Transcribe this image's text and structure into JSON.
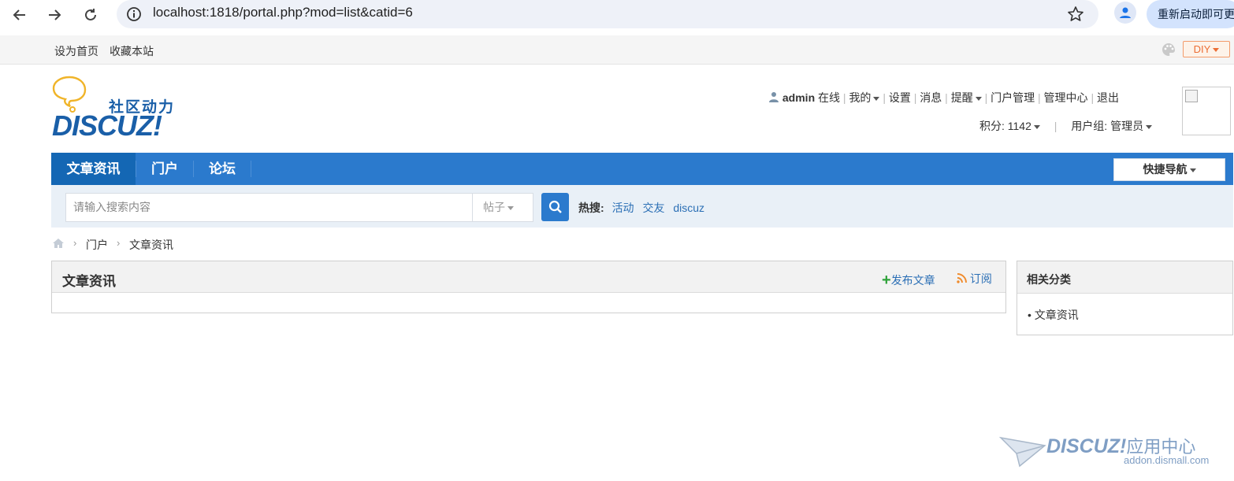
{
  "browser": {
    "url": "localhost:1818/portal.php?mod=list&catid=6",
    "restart_label": "重新启动即可更"
  },
  "toplinks": {
    "set_home": "设为首页",
    "bookmark": "收藏本站",
    "diy": "DIY"
  },
  "logo": {
    "cn": "社区动力",
    "en": "DISCUZ!"
  },
  "user": {
    "name": "admin",
    "status": "在线",
    "menu": [
      "我的",
      "设置",
      "消息",
      "提醒",
      "门户管理",
      "管理中心",
      "退出"
    ],
    "points_label": "积分: 1142",
    "group_label": "用户组: 管理员"
  },
  "nav": {
    "tabs": [
      "文章资讯",
      "门户",
      "论坛"
    ],
    "quick_nav": "快捷导航"
  },
  "search": {
    "placeholder": "请输入搜索内容",
    "type": "帖子",
    "hot_label": "热搜:",
    "hot_items": [
      "活动",
      "交友",
      "discuz"
    ]
  },
  "breadcrumb": [
    "门户",
    "文章资讯"
  ],
  "main": {
    "title": "文章资讯",
    "publish": "发布文章",
    "subscribe": "订阅"
  },
  "side": {
    "title": "相关分类",
    "items": [
      "文章资讯"
    ]
  },
  "watermark": {
    "brand": "DISCUZ!",
    "cn": "应用中心",
    "domain": "addon.dismall.com"
  },
  "colors": {
    "nav_blue": "#2b7acd",
    "nav_active": "#1467b4",
    "link": "#2b6fb5",
    "diy_orange": "#ec6e35"
  }
}
